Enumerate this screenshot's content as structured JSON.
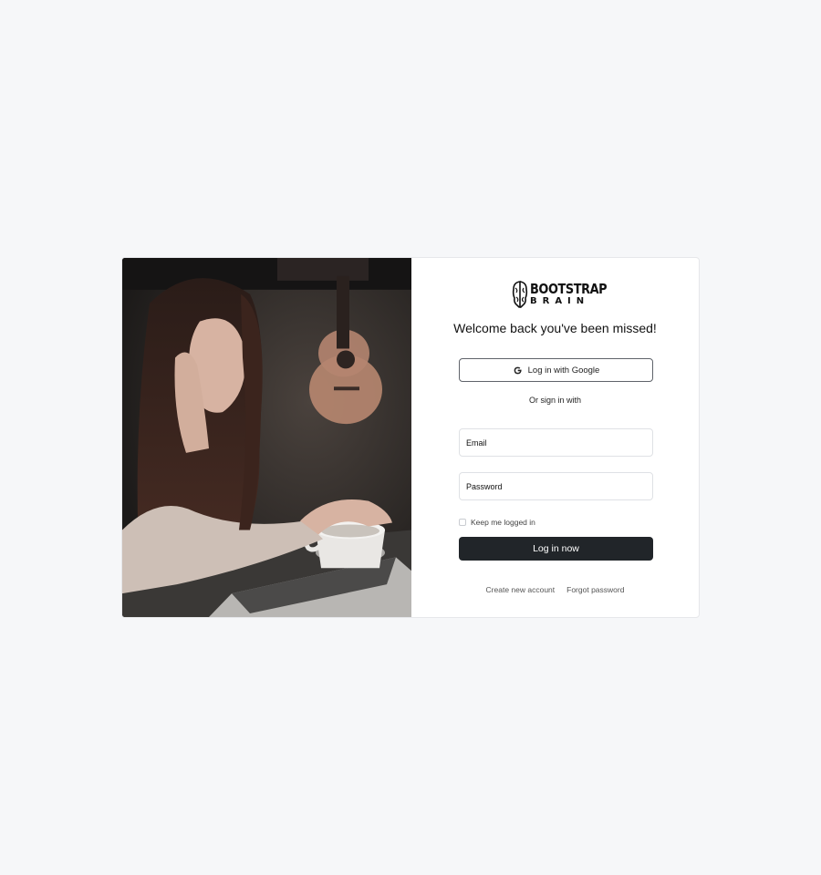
{
  "brand": {
    "line1": "BOOTSTRAP",
    "line2": "BRAIN",
    "icon": "brain-icon"
  },
  "welcome_text": "Welcome back you've been missed!",
  "google_button": {
    "label": "Log in with Google",
    "icon": "google-icon"
  },
  "divider_text": "Or sign in with",
  "email": {
    "placeholder": "Email",
    "value": ""
  },
  "password": {
    "placeholder": "Password",
    "value": ""
  },
  "keep_logged_in": {
    "label": "Keep me logged in",
    "checked": false
  },
  "login_button": {
    "label": "Log in now"
  },
  "links": {
    "create_account": "Create new account",
    "forgot_password": "Forgot password"
  },
  "colors": {
    "page_background": "#f6f7f9",
    "primary_button": "#212529"
  }
}
